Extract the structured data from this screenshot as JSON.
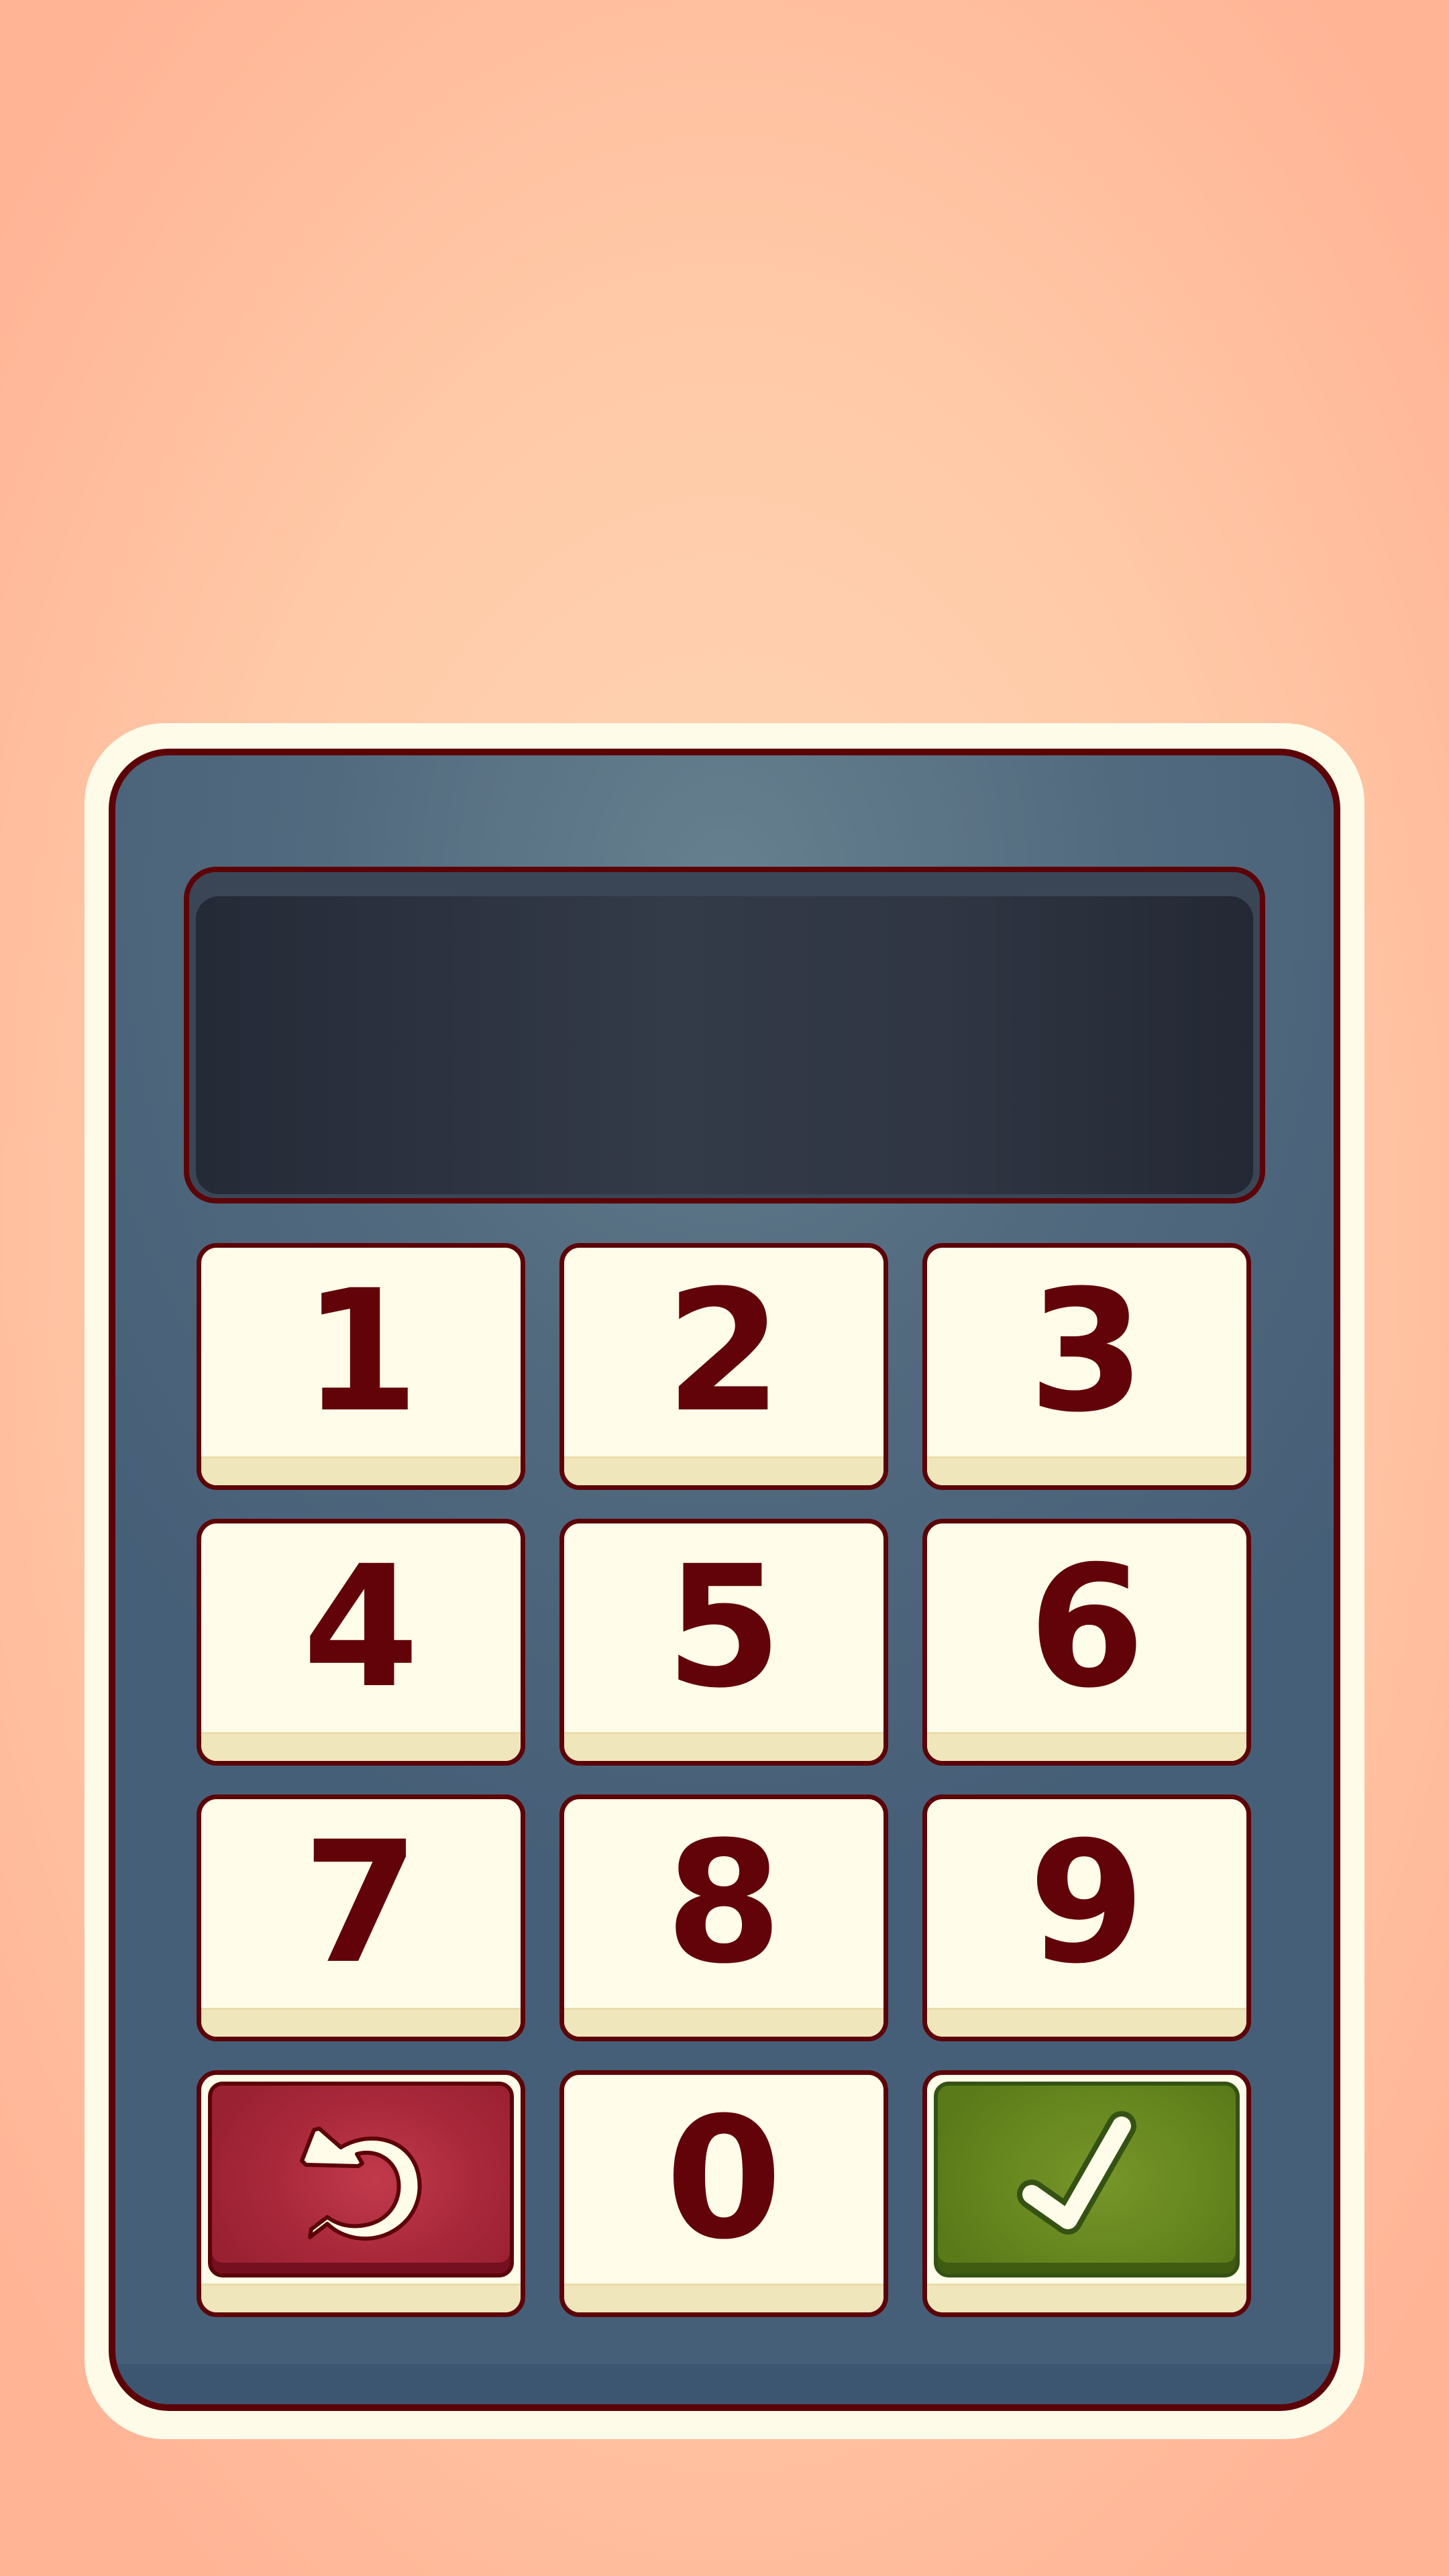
{
  "keypad": {
    "display": {
      "value": ""
    },
    "keys": {
      "k1": "1",
      "k2": "2",
      "k3": "3",
      "k4": "4",
      "k5": "5",
      "k6": "6",
      "k7": "7",
      "k8": "8",
      "k9": "9",
      "k0": "0"
    },
    "actions": {
      "clear_icon": "undo-arrow-icon",
      "confirm_icon": "checkmark-icon"
    },
    "colors": {
      "background": "#ffd2b0",
      "housing": "#526a7e",
      "outline": "#5c0308",
      "key_face": "#fffde9",
      "digit": "#620309",
      "clear_button": "#a8283a",
      "confirm_button": "#66861f"
    }
  }
}
